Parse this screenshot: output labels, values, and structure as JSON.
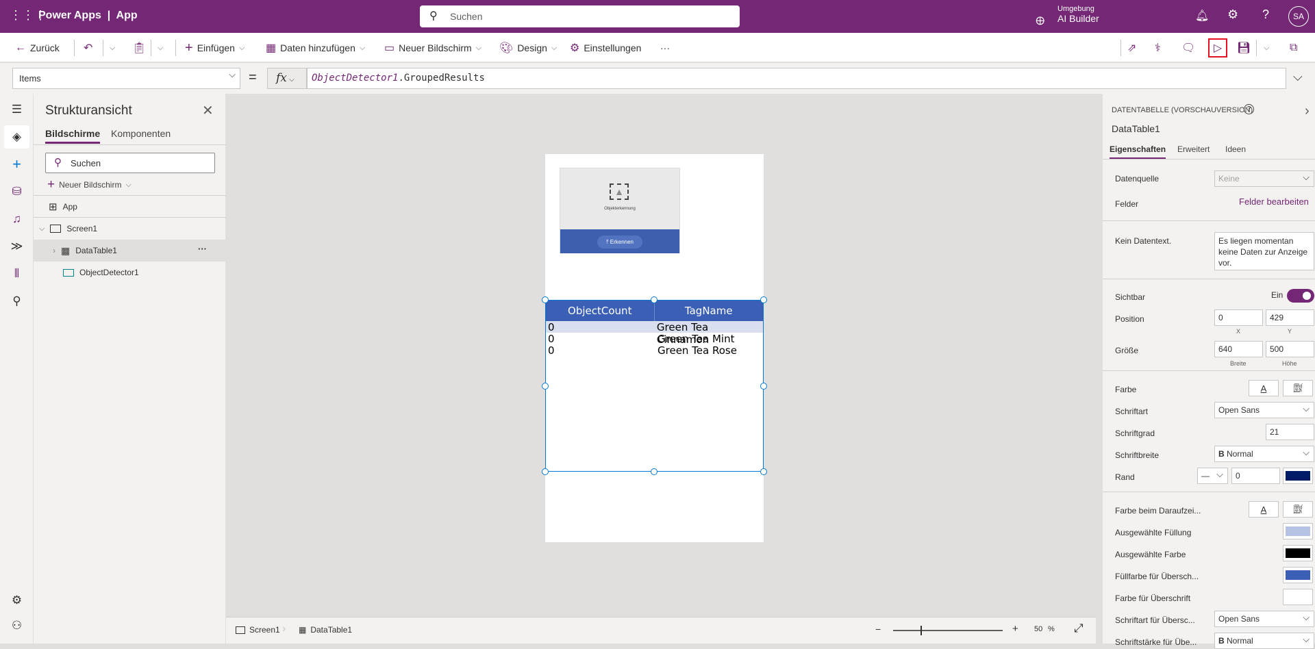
{
  "topbar": {
    "app_title": "Power Apps",
    "app_name": "App",
    "search_placeholder": "Suchen",
    "env_label": "Umgebung",
    "env_name": "AI Builder",
    "avatar": "SA"
  },
  "toolbar": {
    "back": "Zurück",
    "insert": "Einfügen",
    "add_data": "Daten hinzufügen",
    "new_screen": "Neuer Bildschirm",
    "design": "Design",
    "settings": "Einstellungen",
    "more": "···"
  },
  "formula": {
    "property": "Items",
    "equals": "=",
    "fx": "fx",
    "expression_object": "ObjectDetector1",
    "expression_member": ".GroupedResults"
  },
  "tree": {
    "title": "Strukturansicht",
    "tabs": [
      "Bildschirme",
      "Komponenten"
    ],
    "search_placeholder": "Suchen",
    "new_screen": "Neuer Bildschirm",
    "items": [
      "App",
      "Screen1",
      "DataTable1",
      "ObjectDetector1"
    ],
    "more": "···"
  },
  "canvas": {
    "detector_label": "Objekterkennung",
    "detect_button": "Erkennen",
    "table": {
      "columns": [
        "ObjectCount",
        "TagName"
      ],
      "rows": [
        [
          "0",
          "Green Tea Cinnamon"
        ],
        [
          "0",
          "Green Tea Mint"
        ],
        [
          "0",
          "Green Tea Rose"
        ]
      ]
    }
  },
  "status": {
    "breadcrumb": [
      "Screen1",
      "DataTable1"
    ],
    "zoom": "50",
    "zoom_unit": "%",
    "zoom_minus": "−",
    "zoom_plus": "+"
  },
  "props": {
    "type": "DATENTABELLE (VORSCHAUVERSION)",
    "name": "DataTable1",
    "tabs": [
      "Eigenschaften",
      "Erweitert",
      "Ideen"
    ],
    "datasource_label": "Datenquelle",
    "datasource_value": "Keine",
    "fields_label": "Felder",
    "fields_link": "Felder bearbeiten",
    "nodata_label": "Kein Datentext.",
    "nodata_value": "Es liegen momentan keine Daten zur Anzeige vor.",
    "visible_label": "Sichtbar",
    "visible_value": "Ein",
    "position_label": "Position",
    "x": "0",
    "y": "429",
    "x_label": "X",
    "y_label": "Y",
    "size_label": "Größe",
    "width": "640",
    "height": "500",
    "width_label": "Breite",
    "height_label": "Höhe",
    "color_label": "Farbe",
    "font_label": "Schriftart",
    "font_value": "Open Sans",
    "fontsize_label": "Schriftgrad",
    "fontsize_value": "21",
    "weight_label": "Schriftbreite",
    "weight_value": "Normal",
    "border_label": "Rand",
    "border_value": "0",
    "hover_label": "Farbe beim Daraufzei...",
    "sel_fill_label": "Ausgewählte Füllung",
    "sel_color_label": "Ausgewählte Farbe",
    "header_fill_label": "Füllfarbe für Übersch...",
    "header_color_label": "Farbe für Überschrift",
    "header_font_label": "Schriftart für Übersc...",
    "header_font_value": "Open Sans",
    "header_weight_label": "Schriftstärke für Übe...",
    "header_weight_value": "Normal"
  },
  "colors": {
    "brand": "#742774",
    "header_fill": "#3a5fb4",
    "border": "#001a66",
    "selected_row": "#d9dfef"
  }
}
